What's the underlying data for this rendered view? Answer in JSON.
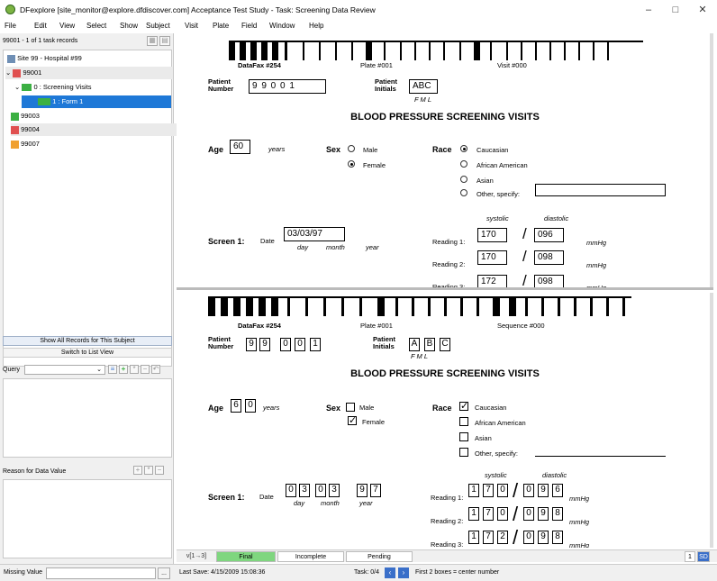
{
  "window": {
    "title": "DFexplore [site_monitor@explore.dfdiscover.com] Acceptance Test Study - Task: Screening Data Review",
    "minimize": "–",
    "maximize": "□",
    "close": "✕"
  },
  "menu": [
    "File",
    "Edit",
    "View",
    "Select",
    "Show",
    "Subject",
    "Visit",
    "Plate",
    "Field",
    "Window",
    "Help"
  ],
  "left": {
    "records_label": "99001 - 1 of 1 task records",
    "tree": {
      "site": "Site 99 - Hospital #99",
      "s1": "99001",
      "visit": "0 : Screening Visits",
      "form": "1 : Form 1",
      "s2": "99003",
      "s3": "99004",
      "s4": "99007"
    },
    "btn_show_all": "Show All Records for This Subject",
    "btn_list": "Switch to List View",
    "query_label": "Query",
    "reason_label": "Reason for Data Value",
    "missing_label": "Missing Value",
    "ellipsis": "..."
  },
  "form": {
    "header": {
      "datafax": "DataFax #254",
      "plate": "Plate #001",
      "visit": "Visit #000",
      "sequence": "Sequence #000"
    },
    "patient_number_label": "Patient Number",
    "patient_number": "9 9 0 0 1",
    "initials_label": "Patient Initials",
    "initials": "ABC",
    "fml": "F   M   L",
    "title": "BLOOD PRESSURE SCREENING VISITS",
    "age_label": "Age",
    "age": "60",
    "years": "years",
    "sex_label": "Sex",
    "male": "Male",
    "female": "Female",
    "race_label": "Race",
    "race_options": [
      "Caucasian",
      "African American",
      "Asian",
      "Other, specify:"
    ],
    "screen_label": "Screen 1:",
    "date_label": "Date",
    "date": "03/03/97",
    "day": "day",
    "month": "month",
    "year": "year",
    "systolic": "systolic",
    "diastolic": "diastolic",
    "mmhg": "mmHg",
    "readings": [
      {
        "label": "Reading 1:",
        "sys": "170",
        "dia": "096"
      },
      {
        "label": "Reading 2:",
        "sys": "170",
        "dia": "098"
      },
      {
        "label": "Reading 3:",
        "sys": "172",
        "dia": "098"
      }
    ],
    "slash": "/"
  },
  "status": {
    "v": "v[1→3]",
    "final": "Final",
    "incomplete": "Incomplete",
    "pending": "Pending",
    "page": "1",
    "sd": "SD"
  },
  "bottom": {
    "last_save": "Last Save: 4/15/2009 15:08:36",
    "task": "Task: 0/4",
    "hint": "First 2 boxes = center number"
  },
  "colors": {
    "selection": "#1e78d7",
    "final": "#7fd67f",
    "green_icon": "#3cb043",
    "red_icon": "#e05050",
    "orange_icon": "#f0a030"
  }
}
